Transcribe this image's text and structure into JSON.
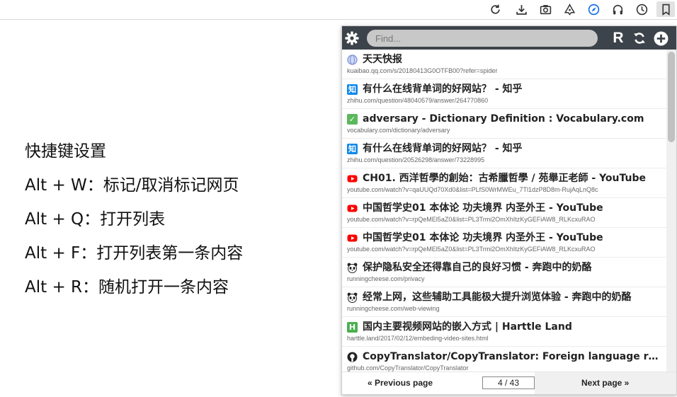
{
  "toolbar": {
    "icons": [
      "reload-icon",
      "download-icon",
      "camera-icon",
      "puzzle-icon",
      "compass-icon",
      "headphones-icon",
      "history-clock-icon",
      "bookmark-icon"
    ]
  },
  "help": {
    "title": "快捷键设置",
    "lines": [
      "Alt + W：标记/取消标记网页",
      "Alt + Q：打开列表",
      "Alt + F：打开列表第一条内容",
      "Alt + R：随机打开一条内容"
    ]
  },
  "popup": {
    "search_placeholder": "Find...",
    "random_label": "R",
    "items": [
      {
        "icon": "globe-icon",
        "color": "#7a8fd8",
        "badge": "",
        "title": "天天快报",
        "url": "kuaibao.qq.com/s/20180413G0OTFB00?refer=spider"
      },
      {
        "icon": "zhihu-icon",
        "color": "#0f88eb",
        "badge": "知",
        "title": "有什么在线背单词的好网站？ - 知乎",
        "url": "zhihu.com/question/48040579/answer/264770860"
      },
      {
        "icon": "vocabulary-check-icon",
        "color": "#5cb85c",
        "badge": "✓",
        "title": "adversary - Dictionary Definition : Vocabulary.com",
        "url": "vocabulary.com/dictionary/adversary"
      },
      {
        "icon": "zhihu-icon",
        "color": "#0f88eb",
        "badge": "知",
        "title": "有什么在线背单词的好网站？ - 知乎",
        "url": "zhihu.com/question/20526298/answer/73228995"
      },
      {
        "icon": "youtube-icon",
        "color": "#ff0000",
        "badge": "▶",
        "title": "CH01. 西洋哲學的創始：古希臘哲學 / 苑舉正老師 - YouTube",
        "url": "youtube.com/watch?v=qaUUQd70Xd0&list=PLfS0WrMWEu_7Tl1dzP8D8m-RujAqLnQ8c"
      },
      {
        "icon": "youtube-icon",
        "color": "#ff0000",
        "badge": "▶",
        "title": "中国哲学史01 本体论 功夫境界 内圣外王 - YouTube",
        "url": "youtube.com/watch?v=rpQeMEl5aZ0&list=PL3Trmi2OmXhItzKyGEFiAW8_RLKcxuRAO"
      },
      {
        "icon": "youtube-icon",
        "color": "#ff0000",
        "badge": "▶",
        "title": "中国哲学史01 本体论 功夫境界 内圣外王 - YouTube",
        "url": "youtube.com/watch?v=rpQeMEl5aZ0&list=PL3Trmi2OmXhItzKyGEFiAW8_RLKcxuRAO"
      },
      {
        "icon": "panda-icon",
        "color": "#444444",
        "badge": "🐼",
        "title": "保护隐私安全还得靠自己的良好习惯 - 奔跑中的奶酪",
        "url": "runningcheese.com/privacy"
      },
      {
        "icon": "panda-icon",
        "color": "#444444",
        "badge": "🐼",
        "title": "经常上网，这些辅助工具能极大提升浏览体验 - 奔跑中的奶酪",
        "url": "runningcheese.com/web-viewing"
      },
      {
        "icon": "harttle-icon",
        "color": "#4caf50",
        "badge": "H",
        "title": "国内主要视频网站的嵌入方式 | Harttle Land",
        "url": "harttle.land/2017/02/12/embeding-video-sites.html"
      },
      {
        "icon": "github-icon",
        "color": "#222222",
        "badge": "●",
        "title": "CopyTranslator/CopyTranslator: Foreign language reading and translation assistant",
        "url": "github.com/CopyTranslator/CopyTranslator"
      }
    ],
    "prev_label": "« Previous page",
    "page_indicator": "4 / 43",
    "next_label": "Next page »"
  }
}
